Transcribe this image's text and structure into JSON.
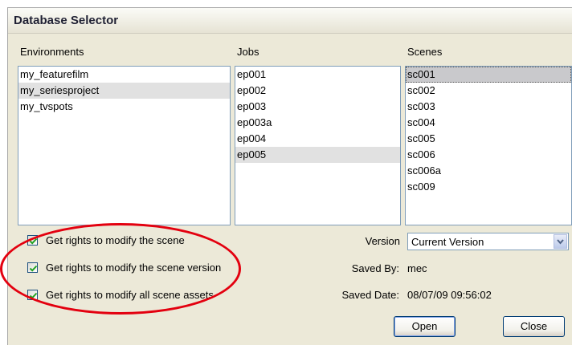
{
  "window": {
    "title": "Database Selector"
  },
  "environments": {
    "header": "Environments",
    "items": [
      {
        "label": "my_featurefilm",
        "selected": false
      },
      {
        "label": "my_seriesproject",
        "selected": true
      },
      {
        "label": "my_tvspots",
        "selected": false
      }
    ]
  },
  "jobs": {
    "header": "Jobs",
    "items": [
      {
        "label": "ep001",
        "selected": false
      },
      {
        "label": "ep002",
        "selected": false
      },
      {
        "label": "ep003",
        "selected": false
      },
      {
        "label": "ep003a",
        "selected": false
      },
      {
        "label": "ep004",
        "selected": false
      },
      {
        "label": "ep005",
        "selected": true
      }
    ]
  },
  "scenes": {
    "header": "Scenes",
    "items": [
      {
        "label": "sc001",
        "selected": true
      },
      {
        "label": "sc002",
        "selected": false
      },
      {
        "label": "sc003",
        "selected": false
      },
      {
        "label": "sc004",
        "selected": false
      },
      {
        "label": "sc005",
        "selected": false
      },
      {
        "label": "sc006",
        "selected": false
      },
      {
        "label": "sc006a",
        "selected": false
      },
      {
        "label": "sc009",
        "selected": false
      }
    ]
  },
  "options": [
    {
      "label": "Get rights to modify the scene",
      "checked": true
    },
    {
      "label": "Get rights to modify the scene version",
      "checked": true
    },
    {
      "label": "Get rights to modify all scene assets",
      "checked": true
    }
  ],
  "version": {
    "label": "Version",
    "value": "Current Version"
  },
  "saved_by": {
    "label": "Saved By:",
    "value": "mec"
  },
  "saved_date": {
    "label": "Saved Date:",
    "value": "08/07/09 09:56:02"
  },
  "buttons": {
    "open": "Open",
    "close": "Close"
  },
  "colors": {
    "highlight_oval": "#e3000f",
    "checkmark": "#21a121"
  }
}
